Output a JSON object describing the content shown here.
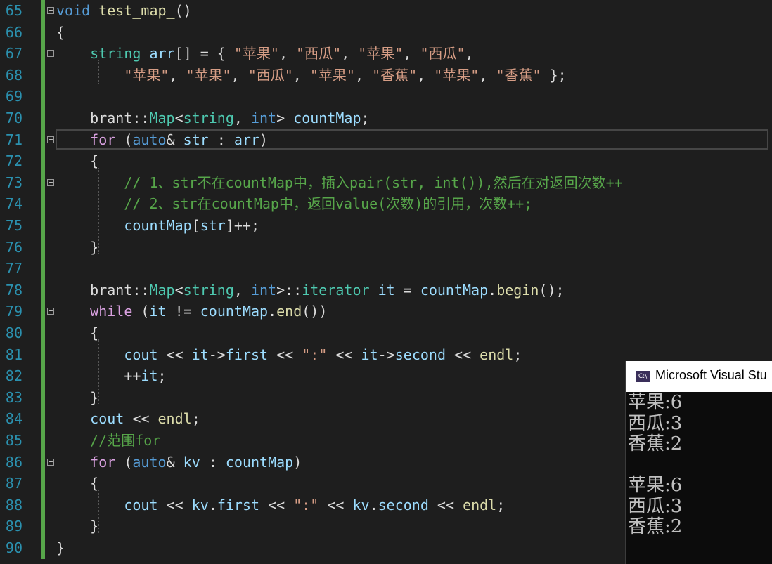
{
  "editor": {
    "lines": [
      {
        "num": "65",
        "tokens": [
          {
            "t": "void",
            "c": "kw"
          },
          {
            "t": " "
          },
          {
            "t": "test_map_",
            "c": "fn"
          },
          {
            "t": "()"
          }
        ]
      },
      {
        "num": "66",
        "tokens": [
          {
            "t": "{"
          }
        ]
      },
      {
        "num": "67",
        "tokens": [
          {
            "t": "    "
          },
          {
            "t": "string",
            "c": "type"
          },
          {
            "t": " "
          },
          {
            "t": "arr",
            "c": "var"
          },
          {
            "t": "[] = { "
          },
          {
            "t": "\"苹果\"",
            "c": "str"
          },
          {
            "t": ", "
          },
          {
            "t": "\"西瓜\"",
            "c": "str"
          },
          {
            "t": ", "
          },
          {
            "t": "\"苹果\"",
            "c": "str"
          },
          {
            "t": ", "
          },
          {
            "t": "\"西瓜\"",
            "c": "str"
          },
          {
            "t": ","
          }
        ]
      },
      {
        "num": "68",
        "tokens": [
          {
            "t": "        "
          },
          {
            "t": "\"苹果\"",
            "c": "str"
          },
          {
            "t": ", "
          },
          {
            "t": "\"苹果\"",
            "c": "str"
          },
          {
            "t": ", "
          },
          {
            "t": "\"西瓜\"",
            "c": "str"
          },
          {
            "t": ", "
          },
          {
            "t": "\"苹果\"",
            "c": "str"
          },
          {
            "t": ", "
          },
          {
            "t": "\"香蕉\"",
            "c": "str"
          },
          {
            "t": ", "
          },
          {
            "t": "\"苹果\"",
            "c": "str"
          },
          {
            "t": ", "
          },
          {
            "t": "\"香蕉\"",
            "c": "str"
          },
          {
            "t": " };"
          }
        ]
      },
      {
        "num": "69",
        "tokens": []
      },
      {
        "num": "70",
        "tokens": [
          {
            "t": "    brant::"
          },
          {
            "t": "Map",
            "c": "type"
          },
          {
            "t": "<"
          },
          {
            "t": "string",
            "c": "type"
          },
          {
            "t": ", "
          },
          {
            "t": "int",
            "c": "kw"
          },
          {
            "t": "> "
          },
          {
            "t": "countMap",
            "c": "var"
          },
          {
            "t": ";"
          }
        ]
      },
      {
        "num": "71",
        "tokens": [
          {
            "t": "    "
          },
          {
            "t": "for",
            "c": "ctl"
          },
          {
            "t": " ("
          },
          {
            "t": "auto",
            "c": "kw"
          },
          {
            "t": "& "
          },
          {
            "t": "str",
            "c": "var"
          },
          {
            "t": " : "
          },
          {
            "t": "arr",
            "c": "var"
          },
          {
            "t": ")"
          }
        ]
      },
      {
        "num": "72",
        "tokens": [
          {
            "t": "    {"
          }
        ]
      },
      {
        "num": "73",
        "tokens": [
          {
            "t": "        "
          },
          {
            "t": "// 1、str不在countMap中，插入pair(str, int()),然后在对返回次数++",
            "c": "cmt"
          }
        ]
      },
      {
        "num": "74",
        "tokens": [
          {
            "t": "        "
          },
          {
            "t": "// 2、str在countMap中，返回value(次数)的引用，次数++;",
            "c": "cmt"
          }
        ]
      },
      {
        "num": "75",
        "tokens": [
          {
            "t": "        "
          },
          {
            "t": "countMap",
            "c": "var"
          },
          {
            "t": "["
          },
          {
            "t": "str",
            "c": "var"
          },
          {
            "t": "]++;"
          }
        ]
      },
      {
        "num": "76",
        "tokens": [
          {
            "t": "    }"
          }
        ]
      },
      {
        "num": "77",
        "tokens": []
      },
      {
        "num": "78",
        "tokens": [
          {
            "t": "    brant::"
          },
          {
            "t": "Map",
            "c": "type"
          },
          {
            "t": "<"
          },
          {
            "t": "string",
            "c": "type"
          },
          {
            "t": ", "
          },
          {
            "t": "int",
            "c": "kw"
          },
          {
            "t": ">::"
          },
          {
            "t": "iterator",
            "c": "type"
          },
          {
            "t": " "
          },
          {
            "t": "it",
            "c": "var"
          },
          {
            "t": " = "
          },
          {
            "t": "countMap",
            "c": "var"
          },
          {
            "t": "."
          },
          {
            "t": "begin",
            "c": "fn"
          },
          {
            "t": "();"
          }
        ]
      },
      {
        "num": "79",
        "tokens": [
          {
            "t": "    "
          },
          {
            "t": "while",
            "c": "ctl"
          },
          {
            "t": " ("
          },
          {
            "t": "it",
            "c": "var"
          },
          {
            "t": " != "
          },
          {
            "t": "countMap",
            "c": "var"
          },
          {
            "t": "."
          },
          {
            "t": "end",
            "c": "fn"
          },
          {
            "t": "())"
          }
        ]
      },
      {
        "num": "80",
        "tokens": [
          {
            "t": "    {"
          }
        ]
      },
      {
        "num": "81",
        "tokens": [
          {
            "t": "        "
          },
          {
            "t": "cout",
            "c": "var"
          },
          {
            "t": " << "
          },
          {
            "t": "it",
            "c": "var"
          },
          {
            "t": "->"
          },
          {
            "t": "first",
            "c": "var"
          },
          {
            "t": " << "
          },
          {
            "t": "\":\"",
            "c": "str"
          },
          {
            "t": " << "
          },
          {
            "t": "it",
            "c": "var"
          },
          {
            "t": "->"
          },
          {
            "t": "second",
            "c": "var"
          },
          {
            "t": " << "
          },
          {
            "t": "endl",
            "c": "fn"
          },
          {
            "t": ";"
          }
        ]
      },
      {
        "num": "82",
        "tokens": [
          {
            "t": "        ++"
          },
          {
            "t": "it",
            "c": "var"
          },
          {
            "t": ";"
          }
        ]
      },
      {
        "num": "83",
        "tokens": [
          {
            "t": "    }"
          }
        ]
      },
      {
        "num": "84",
        "tokens": [
          {
            "t": "    "
          },
          {
            "t": "cout",
            "c": "var"
          },
          {
            "t": " << "
          },
          {
            "t": "endl",
            "c": "fn"
          },
          {
            "t": ";"
          }
        ]
      },
      {
        "num": "85",
        "tokens": [
          {
            "t": "    "
          },
          {
            "t": "//范围for",
            "c": "cmt"
          }
        ]
      },
      {
        "num": "86",
        "tokens": [
          {
            "t": "    "
          },
          {
            "t": "for",
            "c": "ctl"
          },
          {
            "t": " ("
          },
          {
            "t": "auto",
            "c": "kw"
          },
          {
            "t": "& "
          },
          {
            "t": "kv",
            "c": "var"
          },
          {
            "t": " : "
          },
          {
            "t": "countMap",
            "c": "var"
          },
          {
            "t": ")"
          }
        ]
      },
      {
        "num": "87",
        "tokens": [
          {
            "t": "    {"
          }
        ]
      },
      {
        "num": "88",
        "tokens": [
          {
            "t": "        "
          },
          {
            "t": "cout",
            "c": "var"
          },
          {
            "t": " << "
          },
          {
            "t": "kv",
            "c": "var"
          },
          {
            "t": "."
          },
          {
            "t": "first",
            "c": "var"
          },
          {
            "t": " << "
          },
          {
            "t": "\":\"",
            "c": "str"
          },
          {
            "t": " << "
          },
          {
            "t": "kv",
            "c": "var"
          },
          {
            "t": "."
          },
          {
            "t": "second",
            "c": "var"
          },
          {
            "t": " << "
          },
          {
            "t": "endl",
            "c": "fn"
          },
          {
            "t": ";"
          }
        ]
      },
      {
        "num": "89",
        "tokens": [
          {
            "t": "    }"
          }
        ]
      },
      {
        "num": "90",
        "tokens": [
          {
            "t": "}"
          }
        ]
      }
    ],
    "fold_markers": [
      "65",
      "67",
      "71",
      "73",
      "79",
      "86"
    ]
  },
  "console": {
    "title": "Microsoft Visual Stu",
    "icon_text": "C:\\",
    "output": [
      "苹果:6",
      "西瓜:3",
      "香蕉:2",
      "",
      "苹果:6",
      "西瓜:3",
      "香蕉:2"
    ]
  }
}
